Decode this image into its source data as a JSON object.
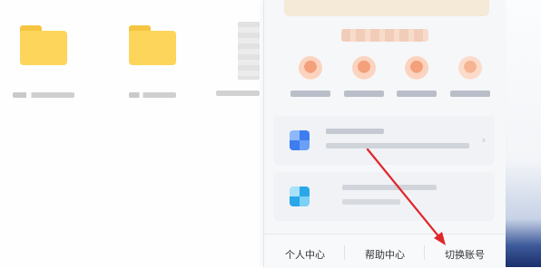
{
  "footer": {
    "personal_center": "个人中心",
    "help_center": "帮助中心",
    "switch_account": "切换账号"
  },
  "colors": {
    "folder": "#fcd55a",
    "annotation_arrow": "#e0262b",
    "panel_background": "#f6f7f9"
  },
  "icons": {
    "folder": "folder-icon",
    "perk": "perk-icon",
    "app1": "app-grid-icon",
    "app2": "app-grid-icon"
  }
}
